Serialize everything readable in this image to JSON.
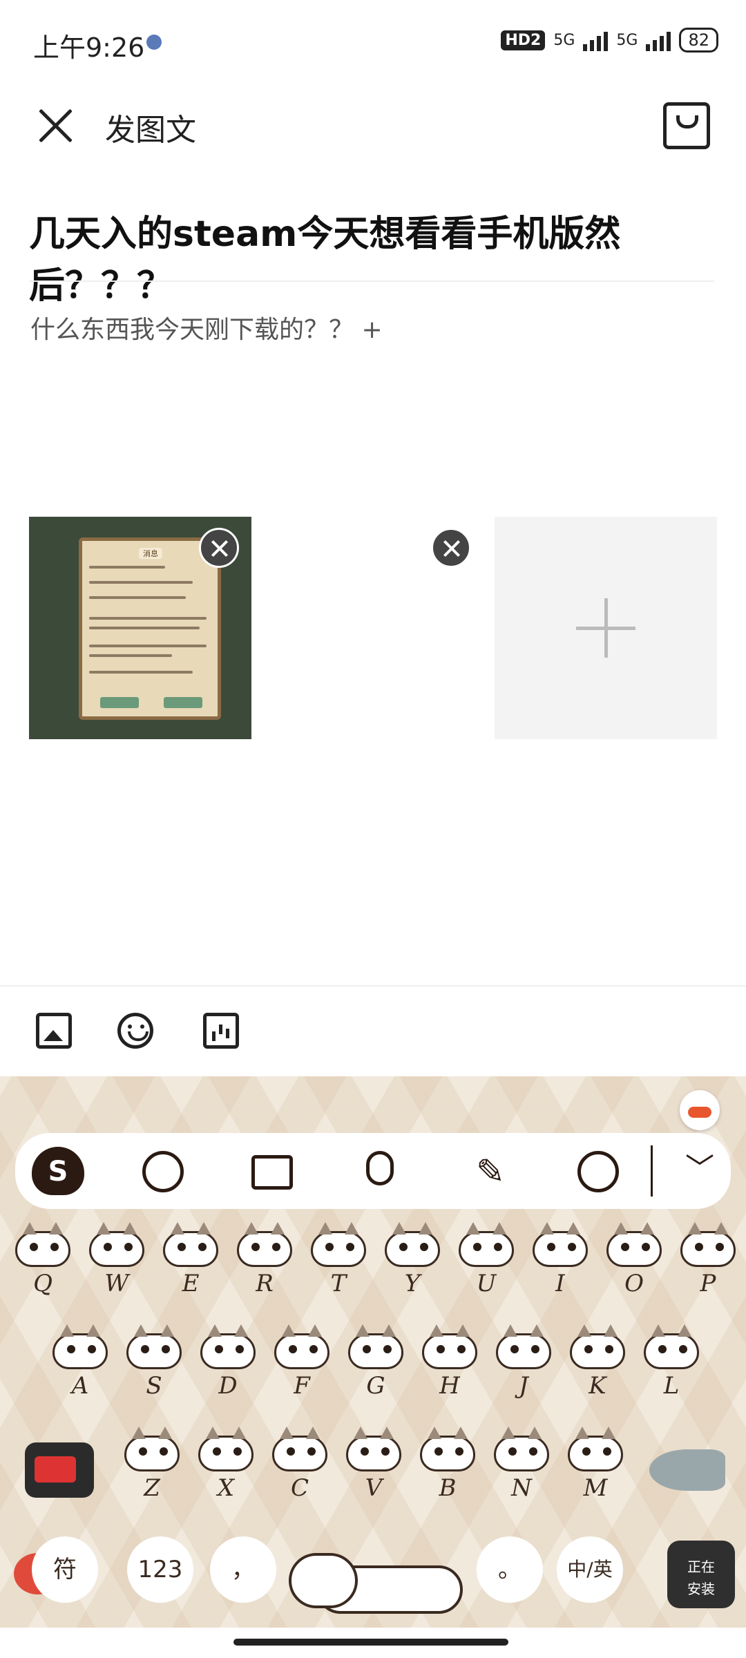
{
  "status": {
    "time": "上午9:26",
    "hd": "HD2",
    "net1": "5G",
    "net2": "5G",
    "battery": "82"
  },
  "header": {
    "title": "发图文"
  },
  "post": {
    "title": "几天入的steam今天想看看手机版然后？？？",
    "body": "什么东西我今天刚下载的？？ +",
    "image_dialog": {
      "title": "消息"
    }
  },
  "keyboard": {
    "logo": "S",
    "handwrite_glyph": "✎",
    "collapse_glyph": "﹀",
    "row1": [
      "Q",
      "W",
      "E",
      "R",
      "T",
      "Y",
      "U",
      "I",
      "O",
      "P"
    ],
    "row2": [
      "A",
      "S",
      "D",
      "F",
      "G",
      "H",
      "J",
      "K",
      "L"
    ],
    "row3": [
      "Z",
      "X",
      "C",
      "V",
      "B",
      "N",
      "M"
    ],
    "symbols_key": "符",
    "numbers_key": "123",
    "comma_key": "，",
    "period_key": "。",
    "lang_key": "中/英"
  },
  "install_badge": {
    "line1": "正在",
    "line2": "安装"
  }
}
